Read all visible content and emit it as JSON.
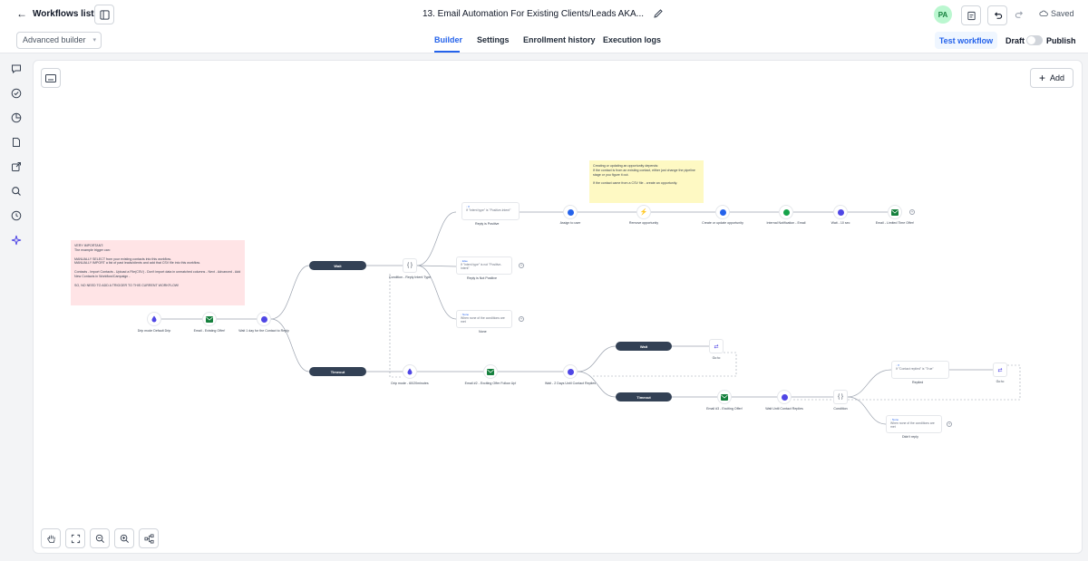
{
  "header": {
    "back_label": "Workflows list",
    "title": "13. Email Automation For Existing Clients/Leads AKA...",
    "avatar": "PA",
    "saved_label": "Saved"
  },
  "subnav": {
    "builder_mode": "Advanced builder",
    "tabs": [
      "Builder",
      "Settings",
      "Enrollment history",
      "Execution logs"
    ],
    "test_label": "Test workflow",
    "draft_label": "Draft",
    "publish_label": "Publish"
  },
  "canvas": {
    "add_label": "Add",
    "notes": {
      "pink": "VERY IMPORTANT:\nThe example trigger can:\n\nMANUALLY SELECT from your existing contacts into this workflow.\nMANUALLY IMPORT a list of past leads/clients and add that CSV file into this workflow.\n\nContacts - Import Contacts - Upload a File(CSV) - Don't import data in unmatched columns - Next - Advanced - Add New Contacts in Workflow/Campaign -\n\nSO, NO NEED TO ADD A TRIGGER TO THIS CURRENT WORKFLOW!",
      "yellow": "Creating or updating an opportunity depends:\nIf the contact is from an existing contact, either just change the pipeline stage or you figure it out.\n\nIf the contact came from a CSV file - create an opportunity."
    },
    "nodes": {
      "drip1": "Drip mode\nDefault Drip",
      "email1": "Email - Existing Offer!",
      "wait1": "Wait 1 day for the Contact to Reply",
      "cond1": "Condition - Reply Intent Type",
      "branch_pos": "Reply is Positive",
      "branch_pos_rule": "If \"Intent type\" is \"Positive-Intent\"",
      "branch_notpos": "Reply is Not Positive",
      "branch_notpos_rule": "If \"Intent type\" is not \"Positive-Intent\"",
      "branch_none": "None",
      "branch_none_rule": "When none of the conditions are met",
      "assign": "Assign to user",
      "remove_opp": "Remove opportunity",
      "create_opp": "Create or update opportunity",
      "internal": "Internal Notification - Email",
      "wait_hrs": "Wait - 10 sec",
      "email_ltd": "Email - Limited Time Offer!",
      "drip2": "Drip mode - 60/20minutes",
      "email2": "Email #2 - Exciting Offer Follow Up!",
      "wait2": "Wait - 2 Days Until Contact Replies",
      "goto1": "Go to",
      "email3": "Email #3 - Exciting Offer!",
      "wait3": "Wait Until Contact Replies",
      "cond2": "Condition",
      "replied": "Replied",
      "replied_rule": "If \"Contact replied\" is \"True\"",
      "no_reply": "Didn't reply",
      "no_reply_rule": "When none of the conditions are met",
      "goto2": "Go to"
    },
    "pills": {
      "wait_a": "Wait",
      "timeout_a": "Timeout",
      "wait_b": "Wait",
      "timeout_b": "Timeout"
    }
  }
}
